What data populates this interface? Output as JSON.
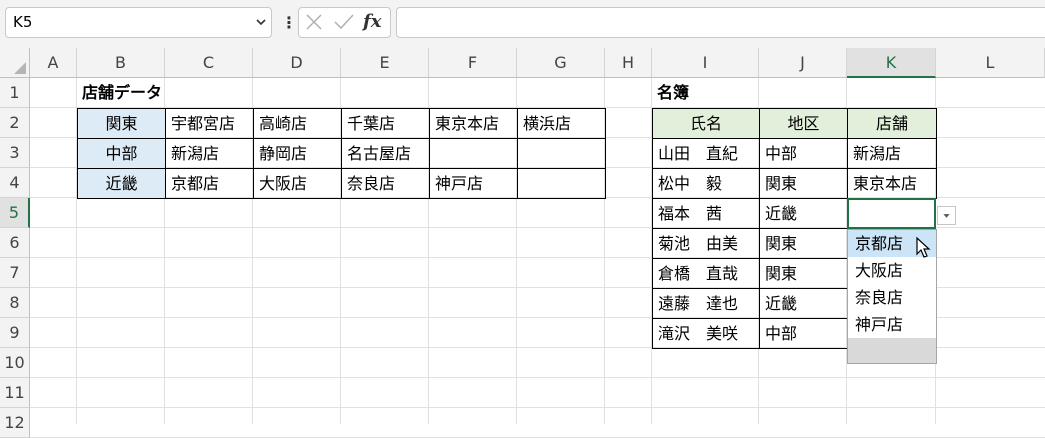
{
  "formula_bar": {
    "name_box": "K5",
    "fx_label": "fx",
    "formula": ""
  },
  "columns": [
    "A",
    "B",
    "C",
    "D",
    "E",
    "F",
    "G",
    "H",
    "I",
    "J",
    "K",
    "L"
  ],
  "rows": [
    "1",
    "2",
    "3",
    "4",
    "5",
    "6",
    "7",
    "8",
    "9",
    "10",
    "11",
    "12"
  ],
  "selected_column": "K",
  "selected_row": "5",
  "store_table": {
    "title": "店舗データ",
    "rows": [
      {
        "region": "関東",
        "stores": [
          "宇都宮店",
          "高崎店",
          "千葉店",
          "東京本店",
          "横浜店"
        ]
      },
      {
        "region": "中部",
        "stores": [
          "新潟店",
          "静岡店",
          "名古屋店",
          "",
          ""
        ]
      },
      {
        "region": "近畿",
        "stores": [
          "京都店",
          "大阪店",
          "奈良店",
          "神戸店",
          ""
        ]
      }
    ]
  },
  "roster": {
    "title": "名簿",
    "headers": [
      "氏名",
      "地区",
      "店舗"
    ],
    "rows": [
      [
        "山田　直紀",
        "中部",
        "新潟店"
      ],
      [
        "松中　毅",
        "関東",
        "東京本店"
      ],
      [
        "福本　茜",
        "近畿",
        ""
      ],
      [
        "菊池　由美",
        "関東",
        ""
      ],
      [
        "倉橋　直哉",
        "関東",
        ""
      ],
      [
        "遠藤　達也",
        "近畿",
        ""
      ],
      [
        "滝沢　美咲",
        "中部",
        ""
      ]
    ]
  },
  "dropdown": {
    "options": [
      "京都店",
      "大阪店",
      "奈良店",
      "神戸店"
    ],
    "highlighted": "京都店"
  },
  "colors": {
    "header_bg": "#ddebf7",
    "roster_header_bg": "#e2efda",
    "selection": "#217346",
    "dropdown_highlight": "#cce4f7"
  }
}
